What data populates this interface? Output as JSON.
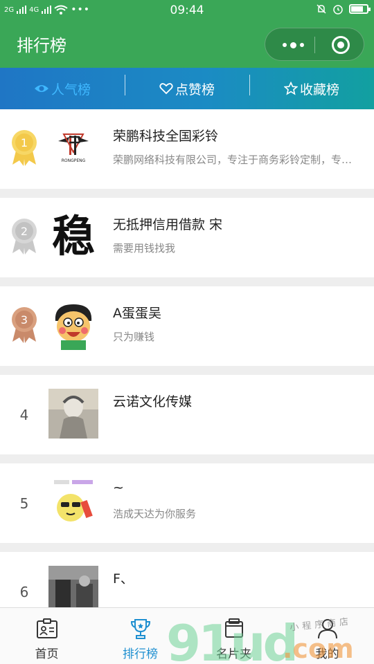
{
  "status_bar": {
    "signal_left": "2G",
    "signal_right": "4G",
    "time": "09:44"
  },
  "header": {
    "title": "排行榜"
  },
  "tabs": [
    {
      "label": "人气榜",
      "icon": "eye-icon",
      "active": true
    },
    {
      "label": "点赞榜",
      "icon": "heart-icon",
      "active": false
    },
    {
      "label": "收藏榜",
      "icon": "star-icon",
      "active": false
    }
  ],
  "rankings": [
    {
      "rank": "1",
      "name": "荣鹏科技全国彩铃",
      "desc": "荣鹏网络科技有限公司，专注于商务彩铃定制，专业录音配乐"
    },
    {
      "rank": "2",
      "name": "无抵押信用借款 宋",
      "desc": "需要用钱找我"
    },
    {
      "rank": "3",
      "name": "A蛋蛋吴",
      "desc": "只为赚钱"
    },
    {
      "rank": "4",
      "name": "云诺文化传媒",
      "desc": ""
    },
    {
      "rank": "5",
      "name": "~",
      "desc": "浩成天达为你服务"
    },
    {
      "rank": "6",
      "name": "F、",
      "desc": ""
    }
  ],
  "avatar_text": {
    "row2_glyph": "稳",
    "row1_logo": "RONGPENG"
  },
  "bottom_nav": [
    {
      "label": "首页",
      "icon": "id-card-icon",
      "active": false
    },
    {
      "label": "排行榜",
      "icon": "trophy-icon",
      "active": true
    },
    {
      "label": "名片夹",
      "icon": "card-folder-icon",
      "active": false
    },
    {
      "label": "我的",
      "icon": "user-icon",
      "active": false
    }
  ],
  "watermark": {
    "main": "91ud",
    "suffix": ".com",
    "tagline": "小程序商店"
  },
  "colors": {
    "primary_green": "#3aa757",
    "tab_active": "#3fb8ff",
    "nav_active": "#1e8fd0",
    "gold": "#f3c94a",
    "silver": "#c8c8c8",
    "bronze": "#c98a6a"
  }
}
